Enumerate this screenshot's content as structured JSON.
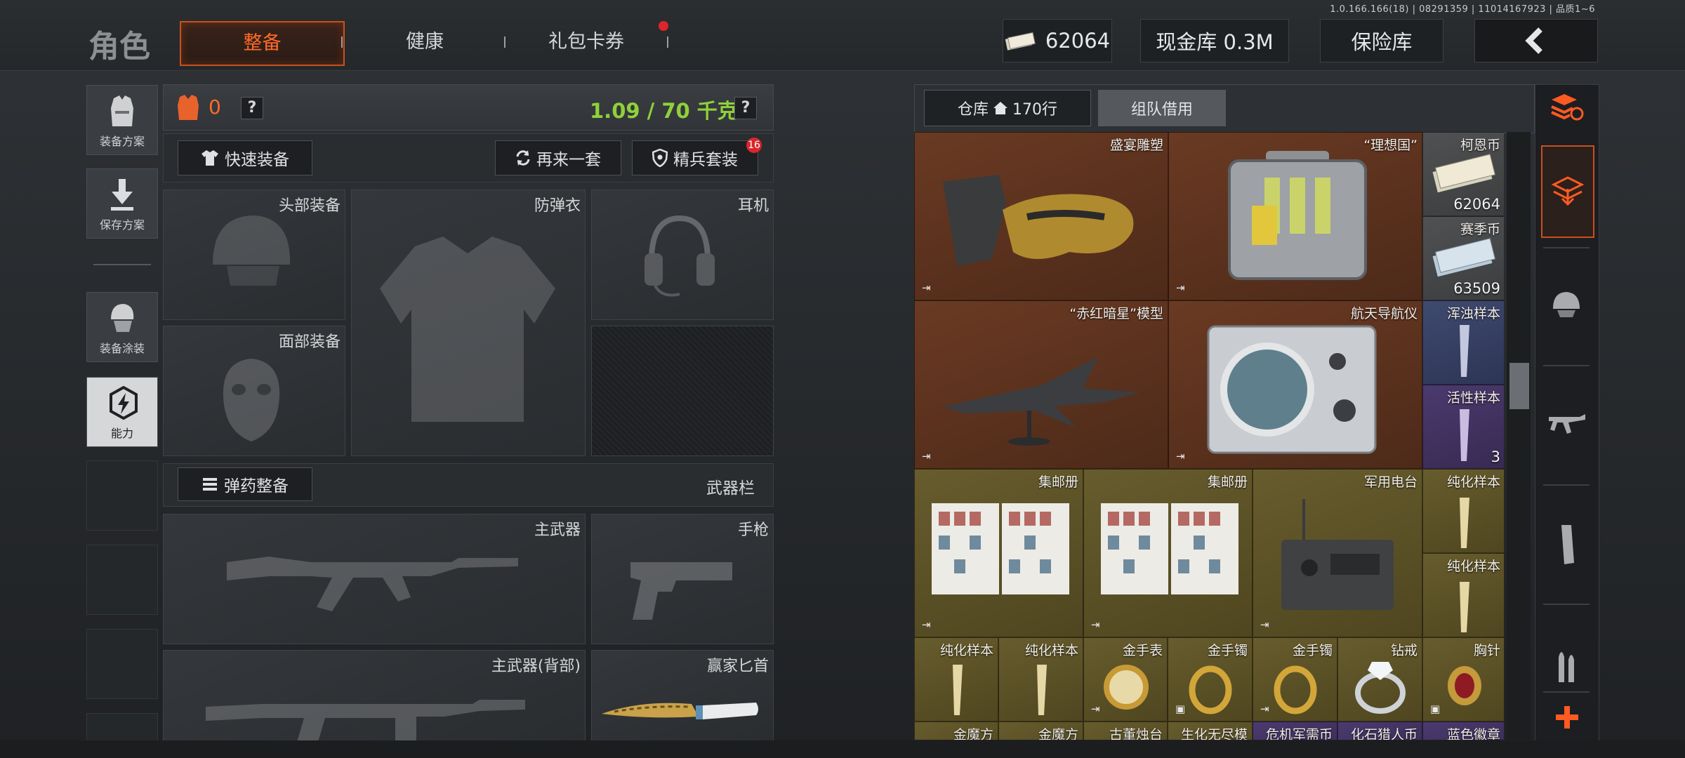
{
  "version": "1.0.166.166(18) | 08291359 | 11014167923 | 品质1~6",
  "header": {
    "title": "角色",
    "tabs": [
      {
        "label": "整备",
        "active": true
      },
      {
        "label": "健康",
        "active": false
      },
      {
        "label": "礼包卡券",
        "active": false,
        "has_notification": true
      }
    ],
    "currency_value": "62064",
    "cash_storage": "现金库 0.3M",
    "safe_box": "保险库"
  },
  "left_menu": [
    {
      "label": "装备方案",
      "icon": "vest-plan-icon"
    },
    {
      "label": "保存方案",
      "icon": "download-icon"
    },
    {
      "label": "装备涂装",
      "icon": "helmet-paint-icon"
    },
    {
      "label": "能力",
      "icon": "ability-icon",
      "active": true
    }
  ],
  "loadout": {
    "armor_value": "0",
    "weight": "1.09 / 70 千克",
    "help": "?",
    "quick_equip": "快速装备",
    "repeat_set": "再来一套",
    "elite_set": "精兵套装",
    "elite_badge": "16",
    "slots": {
      "head": "头部装备",
      "armor": "防弹衣",
      "headset": "耳机",
      "face": "面部装备"
    },
    "ammo_button": "弹药整备",
    "weapon_bar": "武器栏",
    "weapons": {
      "primary": "主武器",
      "pistol": "手枪",
      "primary_back": "主武器(背部)",
      "melee": "赢家匕首"
    }
  },
  "warehouse": {
    "tab_storage": "仓库",
    "rows": "170行",
    "tab_team": "组队借用",
    "items": [
      {
        "label": "盛宴雕塑",
        "rarity": "brown"
      },
      {
        "label": "“理想国”",
        "rarity": "brown"
      },
      {
        "label": "柯恩币",
        "count": "62064",
        "rarity": "grey"
      },
      {
        "label": "赛季币",
        "count": "63509",
        "rarity": "grey"
      },
      {
        "label": "“赤红暗星”模型",
        "rarity": "brown"
      },
      {
        "label": "航天导航仪",
        "rarity": "brown"
      },
      {
        "label": "浑浊样本",
        "rarity": "blue"
      },
      {
        "label": "活性样本",
        "count": "3",
        "rarity": "purple"
      },
      {
        "label": "集邮册",
        "rarity": "gold"
      },
      {
        "label": "集邮册",
        "rarity": "gold"
      },
      {
        "label": "军用电台",
        "rarity": "gold"
      },
      {
        "label": "纯化样本",
        "rarity": "gold"
      },
      {
        "label": "纯化样本",
        "rarity": "gold"
      },
      {
        "label": "纯化样本",
        "rarity": "gold"
      },
      {
        "label": "纯化样本",
        "rarity": "gold"
      },
      {
        "label": "金手表",
        "rarity": "gold"
      },
      {
        "label": "金手镯",
        "rarity": "gold"
      },
      {
        "label": "金手镯",
        "rarity": "gold"
      },
      {
        "label": "钻戒",
        "rarity": "gold"
      },
      {
        "label": "胸针",
        "rarity": "gold"
      },
      {
        "label": "金魔方",
        "rarity": "gold"
      },
      {
        "label": "金魔方",
        "rarity": "gold"
      },
      {
        "label": "古董烛台",
        "rarity": "gold"
      },
      {
        "label": "生化无尽模",
        "rarity": "gold"
      },
      {
        "label": "危机军需币",
        "rarity": "purple"
      },
      {
        "label": "化石猎人币",
        "rarity": "purple"
      },
      {
        "label": "蓝色徽章",
        "rarity": "purple"
      }
    ]
  },
  "colors": {
    "accent_orange": "#ff6a2a",
    "weight_green": "#8fd13a",
    "brown_rarity": "#5a321e",
    "gold_rarity": "#5b5126",
    "purple_rarity": "#3f3160",
    "blue_rarity": "#363f62"
  }
}
